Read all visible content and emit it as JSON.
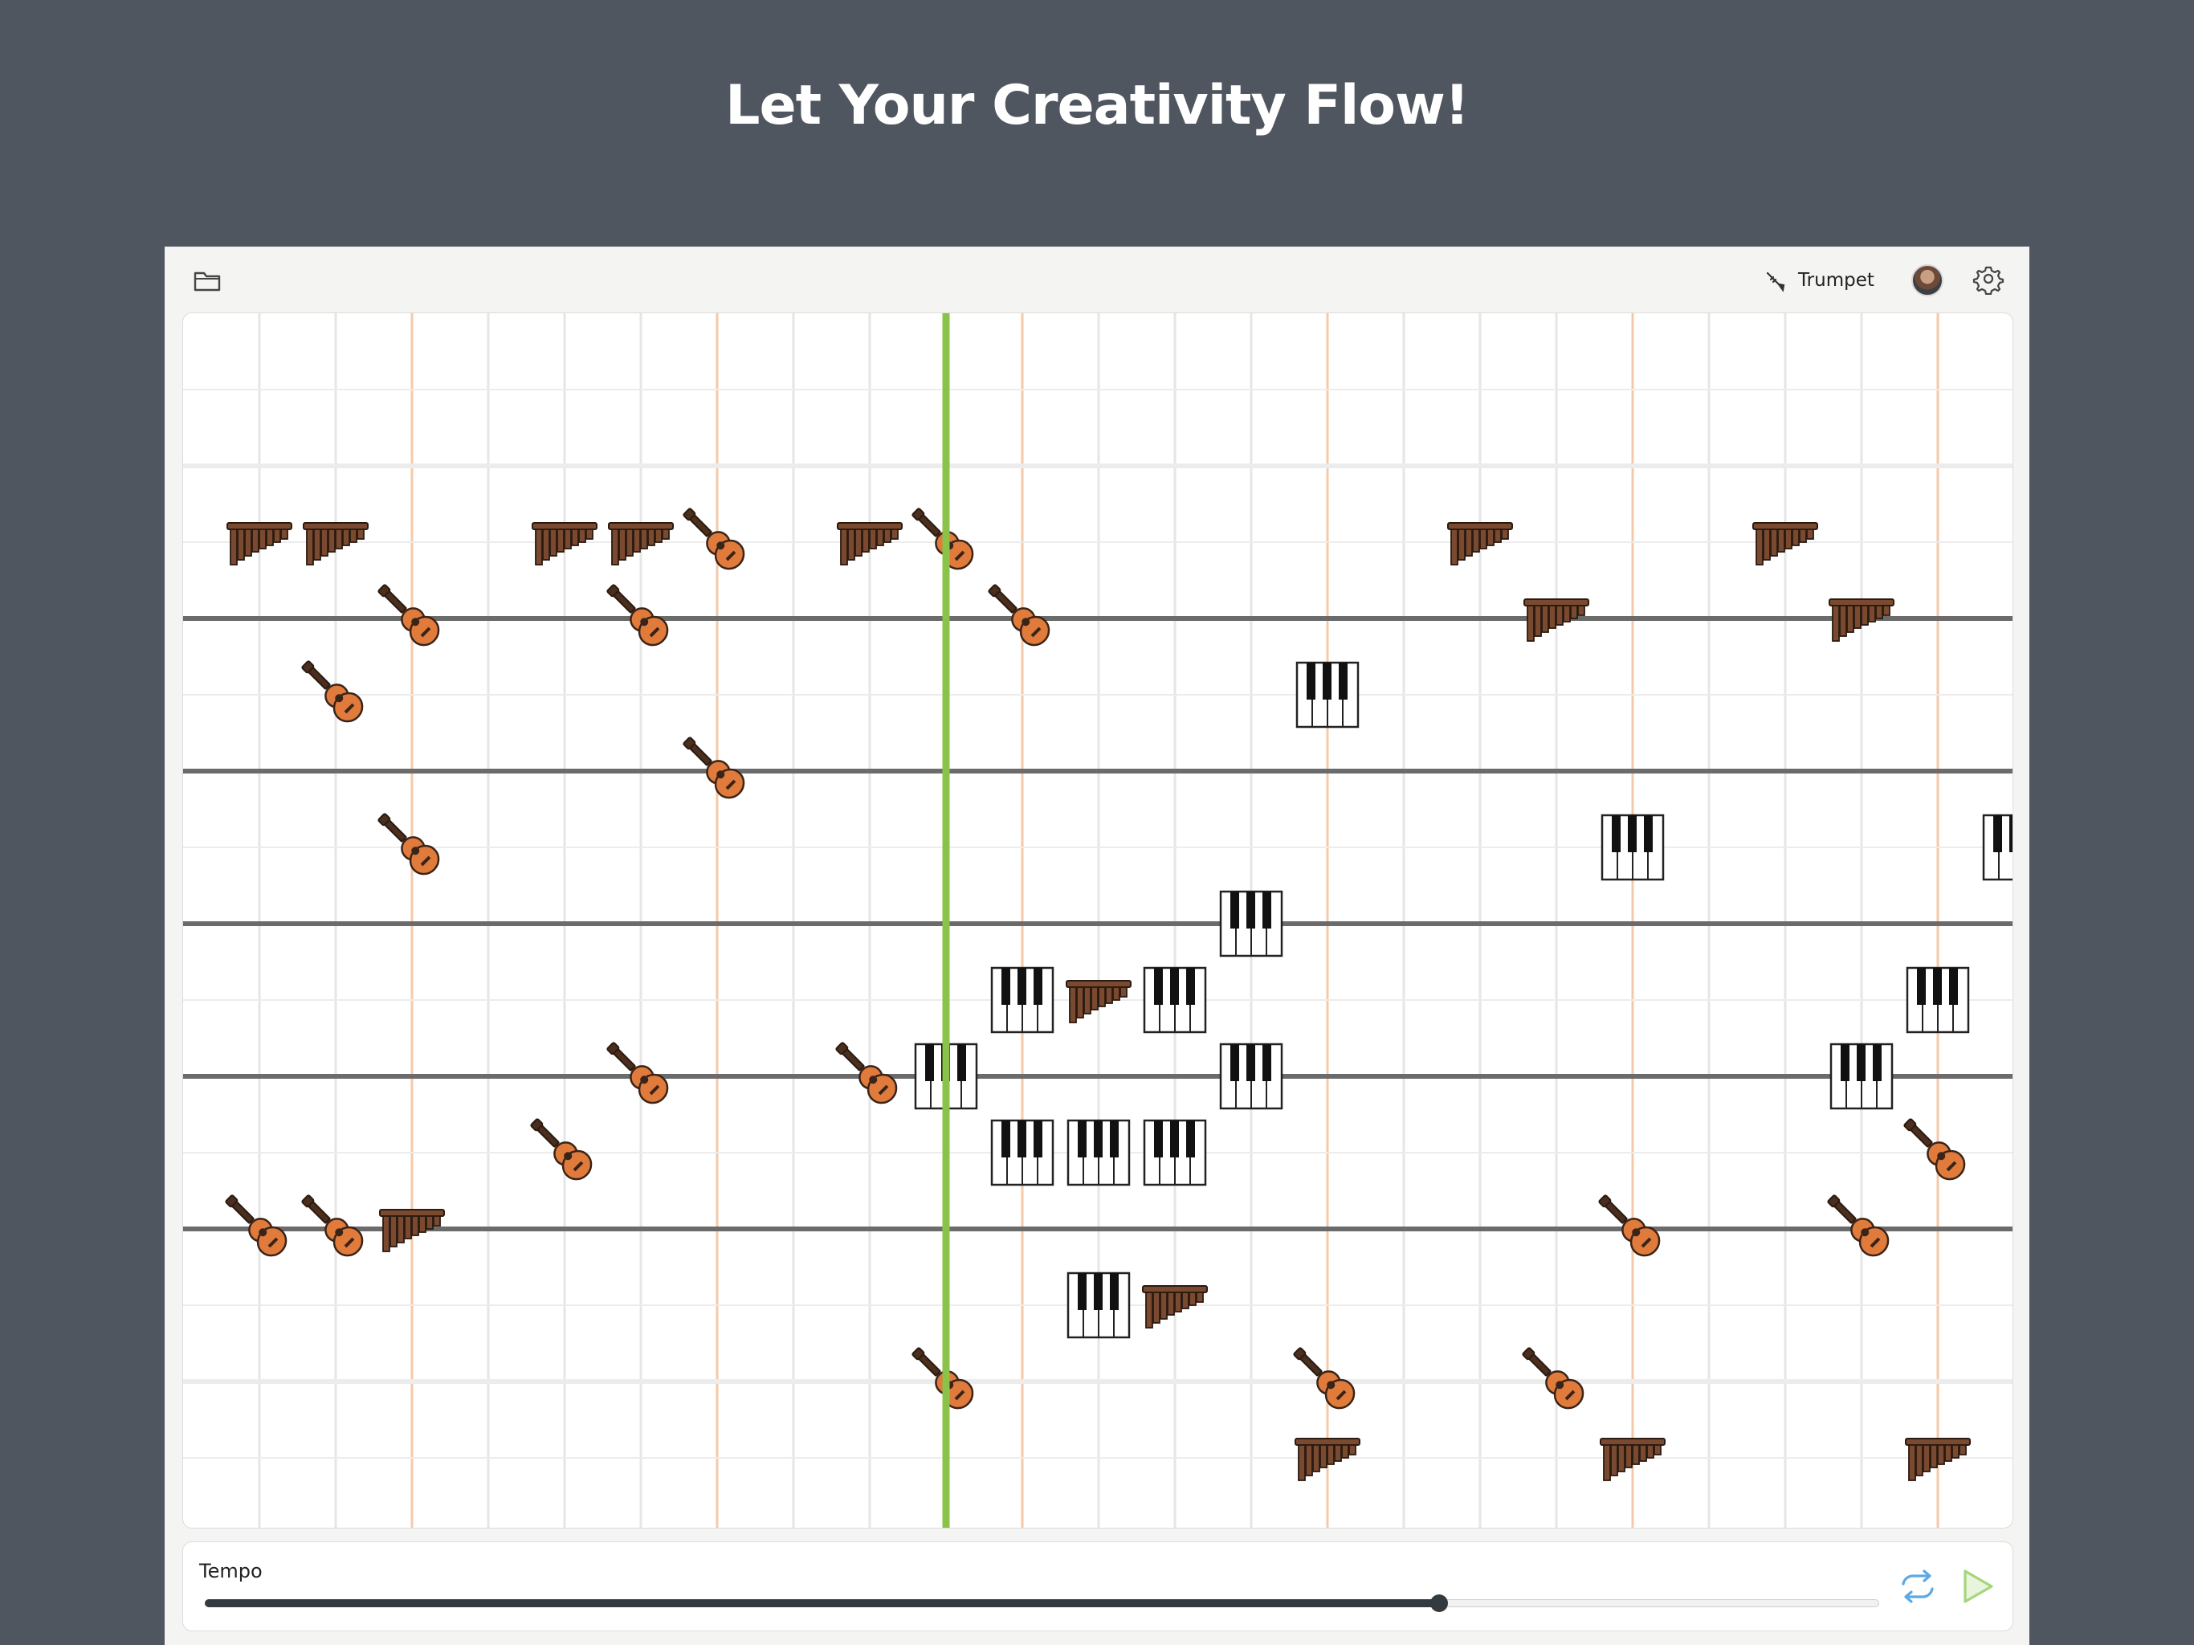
{
  "page": {
    "headline": "Let Your Creativity Flow!"
  },
  "toolbar": {
    "folder_icon": "folder-icon",
    "instrument_icon": "trumpet-icon",
    "instrument_label": "Trumpet",
    "avatar_icon": "user-avatar",
    "settings_icon": "gear-icon"
  },
  "grid": {
    "columns": 24,
    "rows": 16,
    "playhead_column": 10,
    "notes": [
      {
        "instrument": "panflute",
        "col": 1,
        "row": 3
      },
      {
        "instrument": "panflute",
        "col": 2,
        "row": 3
      },
      {
        "instrument": "panflute",
        "col": 5,
        "row": 3
      },
      {
        "instrument": "panflute",
        "col": 6,
        "row": 3
      },
      {
        "instrument": "guitar",
        "col": 7,
        "row": 3
      },
      {
        "instrument": "panflute",
        "col": 9,
        "row": 3
      },
      {
        "instrument": "guitar",
        "col": 10,
        "row": 3
      },
      {
        "instrument": "panflute",
        "col": 17,
        "row": 3
      },
      {
        "instrument": "panflute",
        "col": 21,
        "row": 3
      },
      {
        "instrument": "guitar",
        "col": 3,
        "row": 4
      },
      {
        "instrument": "guitar",
        "col": 6,
        "row": 4
      },
      {
        "instrument": "guitar",
        "col": 11,
        "row": 4
      },
      {
        "instrument": "panflute",
        "col": 18,
        "row": 4
      },
      {
        "instrument": "panflute",
        "col": 22,
        "row": 4
      },
      {
        "instrument": "guitar",
        "col": 2,
        "row": 5
      },
      {
        "instrument": "piano",
        "col": 15,
        "row": 5
      },
      {
        "instrument": "guitar",
        "col": 7,
        "row": 6
      },
      {
        "instrument": "guitar",
        "col": 3,
        "row": 7
      },
      {
        "instrument": "piano",
        "col": 19,
        "row": 7
      },
      {
        "instrument": "piano",
        "col": 24,
        "row": 7
      },
      {
        "instrument": "piano",
        "col": 14,
        "row": 8
      },
      {
        "instrument": "piano",
        "col": 11,
        "row": 9
      },
      {
        "instrument": "panflute",
        "col": 12,
        "row": 9
      },
      {
        "instrument": "piano",
        "col": 13,
        "row": 9
      },
      {
        "instrument": "piano",
        "col": 23,
        "row": 9
      },
      {
        "instrument": "guitar",
        "col": 6,
        "row": 10
      },
      {
        "instrument": "guitar",
        "col": 9,
        "row": 10
      },
      {
        "instrument": "piano",
        "col": 10,
        "row": 10
      },
      {
        "instrument": "piano",
        "col": 14,
        "row": 10
      },
      {
        "instrument": "piano",
        "col": 22,
        "row": 10
      },
      {
        "instrument": "guitar",
        "col": 5,
        "row": 11
      },
      {
        "instrument": "piano",
        "col": 11,
        "row": 11
      },
      {
        "instrument": "piano",
        "col": 12,
        "row": 11
      },
      {
        "instrument": "piano",
        "col": 13,
        "row": 11
      },
      {
        "instrument": "guitar",
        "col": 23,
        "row": 11
      },
      {
        "instrument": "guitar",
        "col": 1,
        "row": 12
      },
      {
        "instrument": "guitar",
        "col": 2,
        "row": 12
      },
      {
        "instrument": "panflute",
        "col": 3,
        "row": 12
      },
      {
        "instrument": "guitar",
        "col": 19,
        "row": 12
      },
      {
        "instrument": "guitar",
        "col": 22,
        "row": 12
      },
      {
        "instrument": "piano",
        "col": 12,
        "row": 13
      },
      {
        "instrument": "panflute",
        "col": 13,
        "row": 13
      },
      {
        "instrument": "guitar",
        "col": 10,
        "row": 14
      },
      {
        "instrument": "guitar",
        "col": 15,
        "row": 14
      },
      {
        "instrument": "guitar",
        "col": 18,
        "row": 14
      },
      {
        "instrument": "panflute",
        "col": 15,
        "row": 15
      },
      {
        "instrument": "panflute",
        "col": 19,
        "row": 15
      },
      {
        "instrument": "panflute",
        "col": 23,
        "row": 15
      }
    ]
  },
  "tempo": {
    "label": "Tempo",
    "value_fraction": 0.737
  },
  "controls": {
    "loop_icon": "loop-icon",
    "play_icon": "play-icon"
  },
  "colors": {
    "background": "#50565f",
    "playhead": "#8bc34a",
    "beat_line": "#f5c9a8",
    "staff_line": "#6b6b6b",
    "guitar_body": "#e07b3c",
    "panflute_wood": "#7a4a30",
    "loop_icon": "#5aa9e6",
    "play_icon": "#a5d67a"
  }
}
